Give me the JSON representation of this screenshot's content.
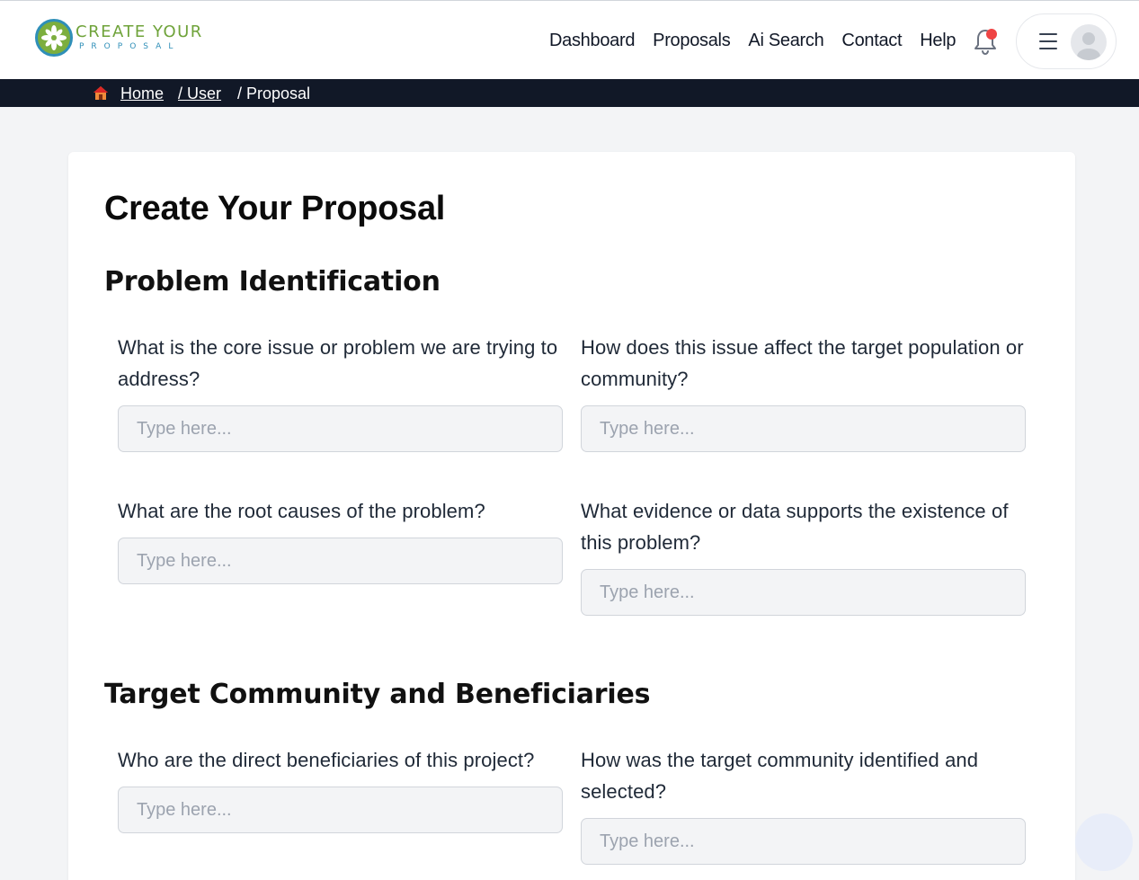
{
  "logo": {
    "line1": "CREATE YOUR",
    "line2": "PROPOSAL",
    "colors": {
      "green": "#6fa33a",
      "blue": "#2f8fb8"
    }
  },
  "nav": {
    "items": [
      {
        "label": "Dashboard"
      },
      {
        "label": "Proposals"
      },
      {
        "label": "Ai Search"
      },
      {
        "label": "Contact"
      },
      {
        "label": "Help"
      }
    ],
    "notification_icon": "bell-icon",
    "notification_dot_color": "#ef4444",
    "menu_icon": "hamburger-menu-icon",
    "avatar_icon": "user-avatar-icon"
  },
  "breadcrumb": {
    "home_icon": "house-icon",
    "items": [
      "Home",
      "/ User",
      "/ Proposal"
    ]
  },
  "page": {
    "title": "Create Your Proposal",
    "sections": [
      {
        "title": "Problem Identification",
        "fields": [
          {
            "label": "What is the core issue or problem we are trying to address?",
            "placeholder": "Type here...",
            "value": ""
          },
          {
            "label": "How does this issue affect the target population or community?",
            "placeholder": "Type here...",
            "value": ""
          },
          {
            "label": "What are the root causes of the problem?",
            "placeholder": "Type here...",
            "value": ""
          },
          {
            "label": "What evidence or data supports the existence of this problem?",
            "placeholder": "Type here...",
            "value": ""
          }
        ]
      },
      {
        "title": "Target Community and Beneficiaries",
        "fields": [
          {
            "label": "Who are the direct beneficiaries of this project?",
            "placeholder": "Type here...",
            "value": ""
          },
          {
            "label": "How was the target community identified and selected?",
            "placeholder": "Type here...",
            "value": ""
          }
        ]
      }
    ]
  },
  "colors": {
    "header_bg": "#ffffff",
    "breadcrumb_bg": "#111827",
    "page_bg": "#f3f4f6",
    "input_bg": "#f3f4f6"
  }
}
